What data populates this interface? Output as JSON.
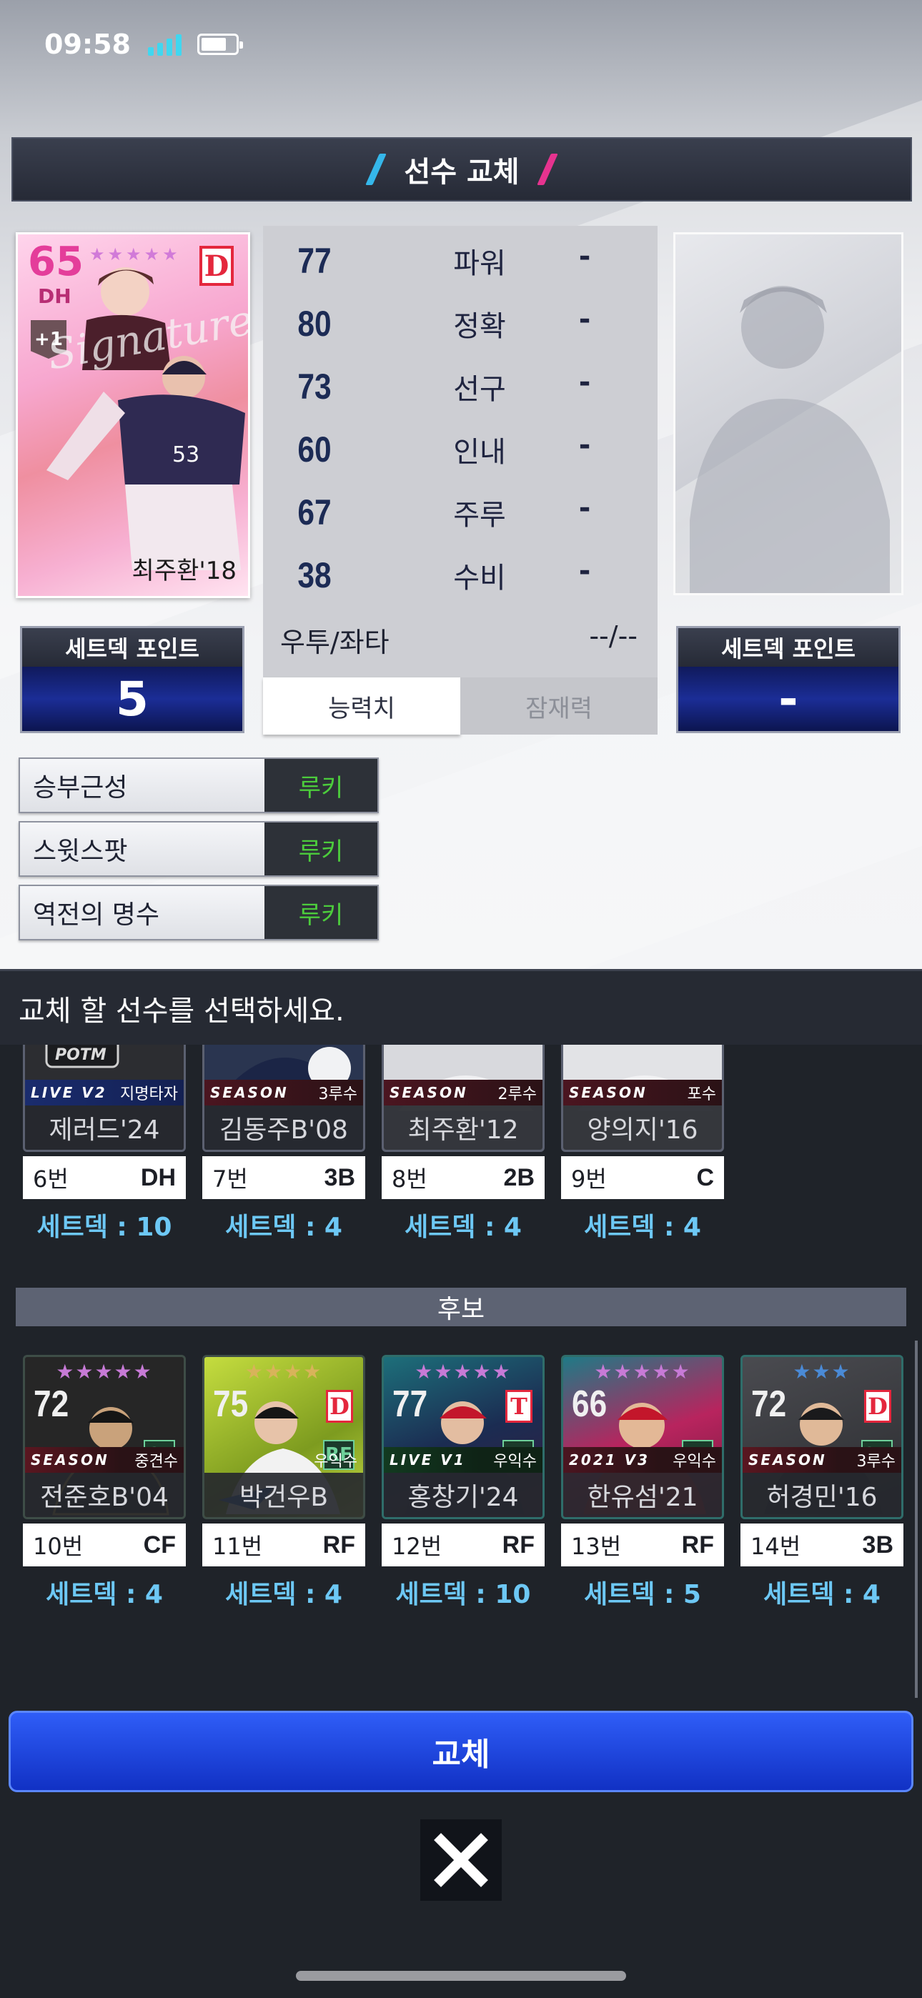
{
  "status_bar": {
    "time": "09:58"
  },
  "header": {
    "title": "선수 교체"
  },
  "current_player": {
    "ovr": "65",
    "position": "DH",
    "enhance": "+1",
    "team_logo": "D",
    "signature_text": "Signature",
    "name": "최주환'18"
  },
  "stats": {
    "rows": [
      {
        "value": "77",
        "label": "파워",
        "compare": "-"
      },
      {
        "value": "80",
        "label": "정확",
        "compare": "-"
      },
      {
        "value": "73",
        "label": "선구",
        "compare": "-"
      },
      {
        "value": "60",
        "label": "인내",
        "compare": "-"
      },
      {
        "value": "67",
        "label": "주루",
        "compare": "-"
      },
      {
        "value": "38",
        "label": "수비",
        "compare": "-"
      }
    ],
    "hand_label": "우투/좌타",
    "hand_value": "--/--",
    "tabs": [
      {
        "label": "능력치",
        "active": true
      },
      {
        "label": "잠재력",
        "active": false
      }
    ]
  },
  "setdeck_left": {
    "title": "세트덱 포인트",
    "value": "5"
  },
  "setdeck_right": {
    "title": "세트덱 포인트",
    "value": "-"
  },
  "traits": [
    {
      "name": "승부근성",
      "grade": "루키"
    },
    {
      "name": "스윗스팟",
      "grade": "루키"
    },
    {
      "name": "역전의 명수",
      "grade": "루키"
    }
  ],
  "instruction": "교체 할 선수를 선택하세요.",
  "lineup_players": [
    {
      "name": "제러드'24",
      "type": "LIVE V2",
      "slot": "지명타자",
      "num": "6번",
      "pos": "DH",
      "setdeck": "세트덱 : 10"
    },
    {
      "name": "김동주B'08",
      "type": "SEASON",
      "slot": "3루수",
      "num": "7번",
      "pos": "3B",
      "setdeck": "세트덱 : 4"
    },
    {
      "name": "최주환'12",
      "type": "SEASON",
      "slot": "2루수",
      "num": "8번",
      "pos": "2B",
      "setdeck": "세트덱 : 4"
    },
    {
      "name": "양의지'16",
      "type": "SEASON",
      "slot": "포수",
      "num": "9번",
      "pos": "C",
      "setdeck": "세트덱 : 4"
    }
  ],
  "bench_title": "후보",
  "bench_players": [
    {
      "ovr": "72",
      "stars": "★★★★★",
      "star_color": "#c77ad6",
      "pos": "CF",
      "logo": "",
      "name": "전준호B'04",
      "type": "SEASON",
      "slot": "중견수",
      "num": "10번",
      "npos": "CF",
      "setdeck": "세트덱 : 4",
      "bg": "#2b2b2b"
    },
    {
      "ovr": "75",
      "stars": "★★★★",
      "star_color": "#d8b35a",
      "pos": "RF",
      "logo": "D",
      "name": "박건우B",
      "type": "",
      "slot": "우익수",
      "num": "11번",
      "npos": "RF",
      "setdeck": "세트덱 : 4",
      "bg": "#b6d03c"
    },
    {
      "ovr": "77",
      "stars": "★★★★★",
      "star_color": "#c77ad6",
      "pos": "RF",
      "logo": "T",
      "name": "홍창기'24",
      "type": "LIVE V1",
      "slot": "우익수",
      "num": "12번",
      "npos": "RF",
      "setdeck": "세트덱 : 10",
      "bg": "#1d2c52"
    },
    {
      "ovr": "66",
      "stars": "★★★★★",
      "star_color": "#c77ad6",
      "pos": "RF",
      "logo": "",
      "name": "한유섬'21",
      "type": "2021 V3",
      "slot": "우익수",
      "num": "13번",
      "npos": "RF",
      "setdeck": "세트덱 : 5",
      "bg": "#b8245e"
    },
    {
      "ovr": "72",
      "stars": "★★★",
      "star_color": "#4a8ad6",
      "pos": "3B",
      "logo": "D",
      "name": "허경민'16",
      "type": "SEASON",
      "slot": "3루수",
      "num": "14번",
      "npos": "3B",
      "setdeck": "세트덱 : 4",
      "bg": "#3b3b3d"
    }
  ],
  "replace_button": "교체",
  "close_icon": "close-x-icon"
}
